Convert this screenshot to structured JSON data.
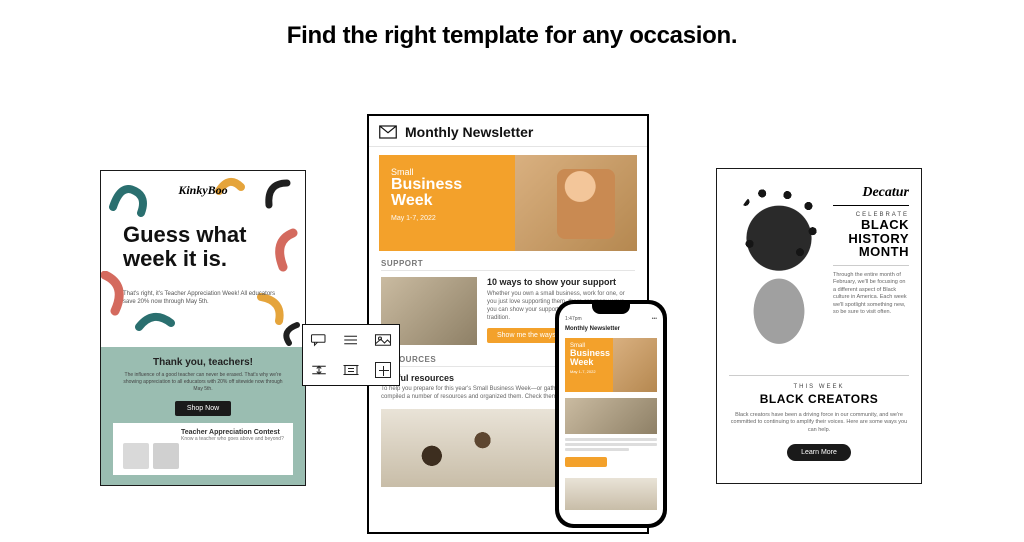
{
  "headline": "Find the right template for any occasion.",
  "left": {
    "logo": "KinkyBoo",
    "title_line1": "Guess what",
    "title_line2": "week it is.",
    "body": "That's right, it's Teacher Appreciation Week! All educators save 20% now through May 5th.",
    "thanks_heading": "Thank you, teachers!",
    "thanks_body": "The influence of a good teacher can never be erased. That's why we're showing appreciation to all educators with 20% off sitewide now through May 5th.",
    "shop_button": "Shop Now",
    "strip_heading": "Teacher Appreciation Contest",
    "strip_body": "Know a teacher who goes above and beyond?"
  },
  "center": {
    "header": "Monthly Newsletter",
    "hero_small": "Small",
    "hero_big1": "Business",
    "hero_big2": "Week",
    "hero_date": "May 1-7, 2022",
    "support_label": "SUPPORT",
    "support_h": "10 ways to show your support",
    "support_p": "Whether you own a small business, work for one, or you just love supporting them, there are many ways you can show your support and celebrate this annual tradition.",
    "support_btn": "Show me the ways",
    "resources_label": "RESOURCES",
    "resources_h": "Useful resources",
    "resources_p": "To help you prepare for this year's Small Business Week—or gather ideas for next year—we've compiled a number of resources and organized them. Check them out."
  },
  "phone": {
    "status_left": "1:47pm",
    "header": "Monthly Newsletter",
    "hero_small": "Small",
    "hero_big1": "Business",
    "hero_big2": "Week",
    "hero_date": "May 1-7, 2022"
  },
  "right": {
    "brand": "Decatur",
    "celebrate": "CELEBRATE",
    "title_l1": "BLACK",
    "title_l2": "HISTORY",
    "title_l3": "MONTH",
    "body": "Through the entire month of February, we'll be focusing on a different aspect of Black culture in America. Each week we'll spotlight something new, so be sure to visit often.",
    "this_week": "THIS WEEK",
    "subhead": "BLACK CREATORS",
    "foot_body": "Black creators have been a driving force in our community, and we're committed to continuing to amplify their voices. Here are some ways you can help.",
    "learn_btn": "Learn More"
  },
  "toolbar": {
    "i1": "comment-icon",
    "i2": "list-icon",
    "i3": "image-icon",
    "i4": "spacer-icon",
    "i5": "layout-icon",
    "i6": "add-block-icon"
  }
}
